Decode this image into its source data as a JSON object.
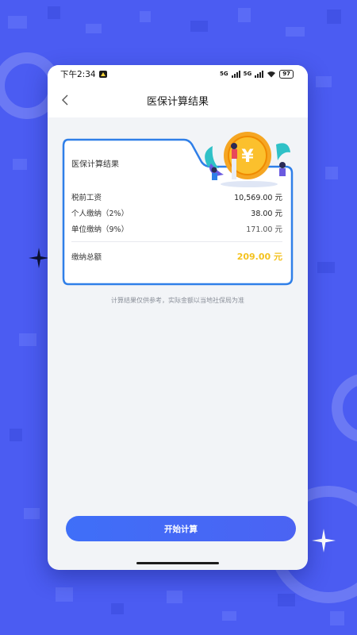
{
  "status_bar": {
    "time": "下午2:34",
    "network_a": "5G",
    "network_b": "5G",
    "battery": "97"
  },
  "header": {
    "title": "医保计算结果"
  },
  "result_card": {
    "title": "医保计算结果",
    "rows": [
      {
        "label": "税前工资",
        "value": "10,569.00 元"
      },
      {
        "label": "个人缴纳（2%）",
        "value": "38.00 元"
      },
      {
        "label": "单位缴纳（9%）",
        "value": "171.00 元"
      }
    ],
    "total": {
      "label": "缴纳总额",
      "value": "209.00 元"
    },
    "coin_symbol": "¥"
  },
  "note": "计算结果仅供参考，实际金额以当地社保局为准",
  "action": {
    "start_label": "开始计算"
  },
  "colors": {
    "background": "#4b5cf2",
    "accent": "#3f6ff8",
    "card_border": "#2f7fe8",
    "total_value": "#f4c21f",
    "coin": "#f5a623"
  }
}
